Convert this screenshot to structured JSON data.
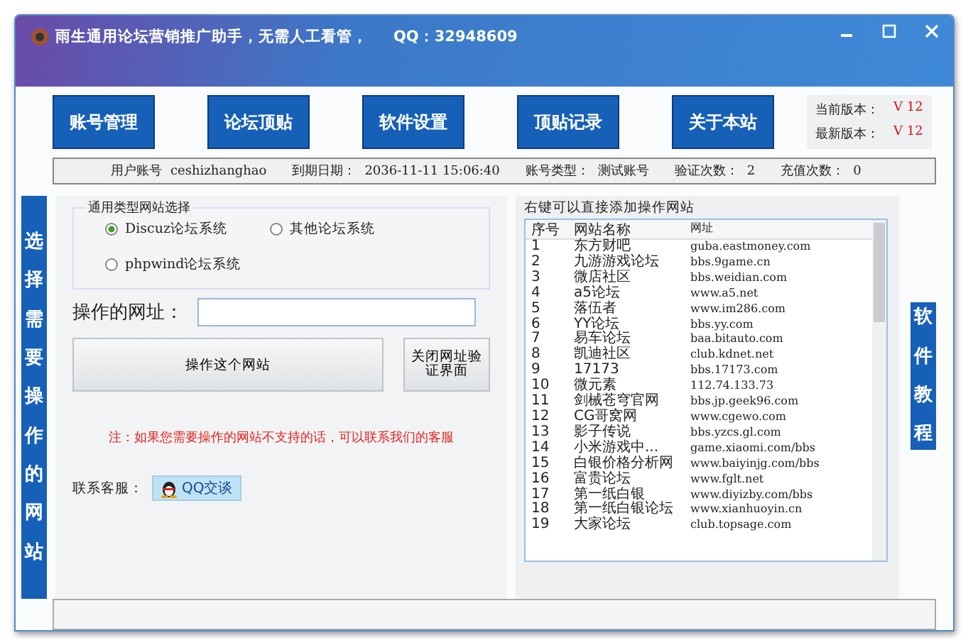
{
  "window": {
    "title": "雨生通用论坛营销推广助手，无需人工看管，",
    "qq": "QQ：32948609"
  },
  "nav_buttons": [
    "账号管理",
    "论坛顶贴",
    "软件设置",
    "顶贴记录",
    "关于本站"
  ],
  "version": [
    {
      "label": "当前版本：",
      "value": "V 12"
    },
    {
      "label": "最新版本：",
      "value": "V 12"
    }
  ],
  "info_bar": [
    {
      "label": "用户账号",
      "value": "ceshizhanghao"
    },
    {
      "label": "到期日期：",
      "value": "2036-11-11 15:06:40"
    },
    {
      "label": "账号类型：",
      "value": "测试账号"
    },
    {
      "label": "验证次数：",
      "value": "2"
    },
    {
      "label": "充值次数：",
      "value": "0"
    }
  ],
  "left_banner": "选择需要操作的网站",
  "site_type": {
    "title": "通用类型网站选择",
    "options": [
      {
        "label": "Discuz论坛系统",
        "selected": true
      },
      {
        "label": "其他论坛系统",
        "selected": false
      },
      {
        "label": "phpwind论坛系统",
        "selected": false
      }
    ]
  },
  "url_field": {
    "label": "操作的网址："
  },
  "actions": [
    "操作这个网站",
    "关闭网址验证界面"
  ],
  "note": "注：如果您需要操作的网站不支持的话，可以联系我们的客服",
  "contact": {
    "label": "联系客服：",
    "button": "QQ交谈"
  },
  "site_list": {
    "title": "右键可以直接添加操作网站",
    "columns": [
      "序号",
      "网站名称",
      "网址"
    ],
    "rows": [
      [
        "1",
        "东方财吧",
        "guba.eastmoney.com"
      ],
      [
        "2",
        "九游游戏论坛",
        "bbs.9game.cn"
      ],
      [
        "3",
        "微店社区",
        "bbs.weidian.com"
      ],
      [
        "4",
        "a5论坛",
        "www.a5.net"
      ],
      [
        "5",
        "落伍者",
        "www.im286.com"
      ],
      [
        "6",
        "YY论坛",
        "bbs.yy.com"
      ],
      [
        "7",
        "易车论坛",
        "baa.bitauto.com"
      ],
      [
        "8",
        "凯迪社区",
        "club.kdnet.net"
      ],
      [
        "9",
        "17173",
        "bbs.17173.com"
      ],
      [
        "10",
        "微元素",
        "112.74.133.73"
      ],
      [
        "11",
        "剑械苍穹官网",
        "bbs.jp.geek96.com"
      ],
      [
        "12",
        "CG哥窝网",
        "www.cgewo.com"
      ],
      [
        "13",
        "影子传说",
        "bbs.yzcs.gl.com"
      ],
      [
        "14",
        "小米游戏中...",
        "game.xiaomi.com/bbs"
      ],
      [
        "15",
        "白银价格分析网",
        "www.baiyinjg.com/bbs"
      ],
      [
        "16",
        "富贵论坛",
        "www.fglt.net"
      ],
      [
        "17",
        "第一纸白银",
        "www.diyizby.com/bbs"
      ],
      [
        "18",
        "第一纸白银论坛",
        "www.xianhuoyin.cn"
      ],
      [
        "19",
        "大家论坛",
        "club.topsage.com"
      ]
    ]
  },
  "right_banner": "软件教程"
}
